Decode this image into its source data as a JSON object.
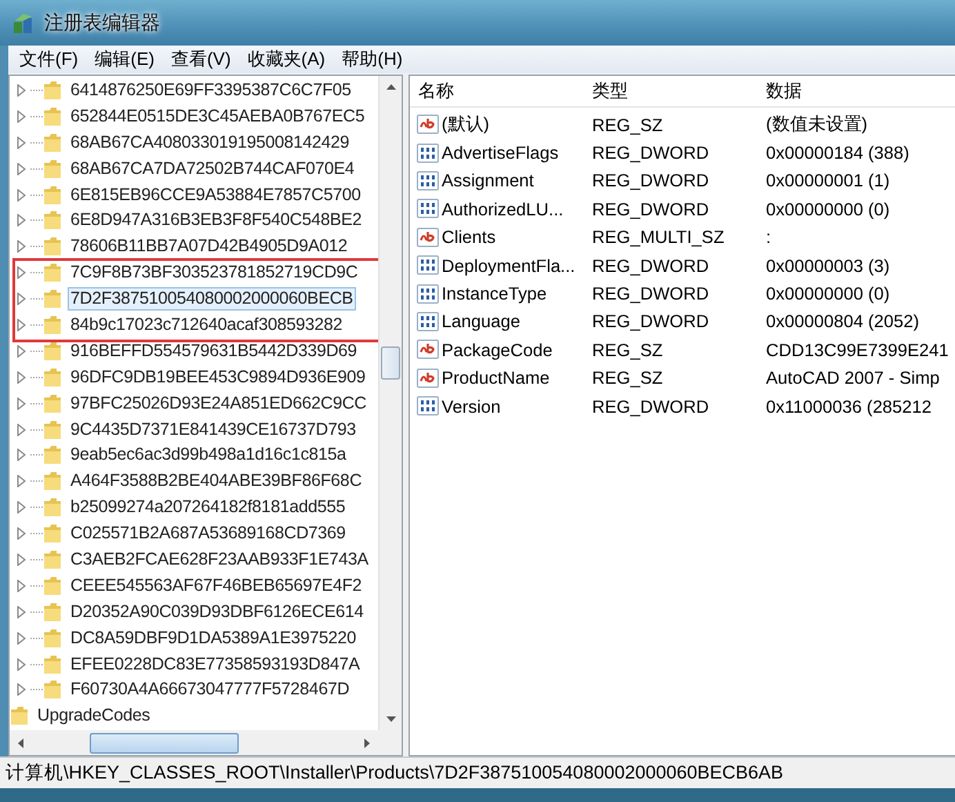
{
  "window": {
    "title": "注册表编辑器"
  },
  "menu": [
    "文件(F)",
    "编辑(E)",
    "查看(V)",
    "收藏夹(A)",
    "帮助(H)"
  ],
  "tree": {
    "items": [
      {
        "label": "6414876250E69FF3395387C6C7F05",
        "expandable": true,
        "selected": false,
        "marked": false
      },
      {
        "label": "652844E0515DE3C45AEBA0B767EC5",
        "expandable": true,
        "selected": false,
        "marked": false
      },
      {
        "label": "68AB67CA408033019195008142429",
        "expandable": true,
        "selected": false,
        "marked": false
      },
      {
        "label": "68AB67CA7DA72502B744CAF070E4",
        "expandable": true,
        "selected": false,
        "marked": false
      },
      {
        "label": "6E815EB96CCE9A53884E7857C5700",
        "expandable": true,
        "selected": false,
        "marked": false
      },
      {
        "label": "6E8D947A316B3EB3F8F540C548BE2",
        "expandable": true,
        "selected": false,
        "marked": false
      },
      {
        "label": "78606B11BB7A07D42B4905D9A012",
        "expandable": true,
        "selected": false,
        "marked": false
      },
      {
        "label": "7C9F8B73BF303523781852719CD9C",
        "expandable": true,
        "selected": false,
        "marked": true
      },
      {
        "label": "7D2F387510054080002000060BECB",
        "expandable": true,
        "selected": true,
        "marked": true
      },
      {
        "label": "84b9c17023c712640acaf308593282",
        "expandable": true,
        "selected": false,
        "marked": true
      },
      {
        "label": "916BEFFD554579631B5442D339D69",
        "expandable": true,
        "selected": false,
        "marked": false
      },
      {
        "label": "96DFC9DB19BEE453C9894D936E909",
        "expandable": true,
        "selected": false,
        "marked": false
      },
      {
        "label": "97BFC25026D93E24A851ED662C9CC",
        "expandable": true,
        "selected": false,
        "marked": false
      },
      {
        "label": "9C4435D7371E841439CE16737D793",
        "expandable": true,
        "selected": false,
        "marked": false
      },
      {
        "label": "9eab5ec6ac3d99b498a1d16c1c815a",
        "expandable": true,
        "selected": false,
        "marked": false
      },
      {
        "label": "A464F3588B2BE404ABE39BF86F68C",
        "expandable": true,
        "selected": false,
        "marked": false
      },
      {
        "label": "b25099274a207264182f8181add555",
        "expandable": true,
        "selected": false,
        "marked": false
      },
      {
        "label": "C025571B2A687A53689168CD7369",
        "expandable": true,
        "selected": false,
        "marked": false
      },
      {
        "label": "C3AEB2FCAE628F23AAB933F1E743A",
        "expandable": true,
        "selected": false,
        "marked": false
      },
      {
        "label": "CEEE545563AF67F46BEB65697E4F2",
        "expandable": true,
        "selected": false,
        "marked": false
      },
      {
        "label": "D20352A90C039D93DBF6126ECE614",
        "expandable": true,
        "selected": false,
        "marked": false
      },
      {
        "label": "DC8A59DBF9D1DA5389A1E3975220",
        "expandable": true,
        "selected": false,
        "marked": false
      },
      {
        "label": "EFEE0228DC83E77358593193D847A",
        "expandable": true,
        "selected": false,
        "marked": false
      },
      {
        "label": "F60730A4A66673047777F5728467D",
        "expandable": true,
        "selected": false,
        "marked": false
      },
      {
        "label": "UpgradeCodes",
        "expandable": false,
        "selected": false,
        "marked": false
      }
    ]
  },
  "values": {
    "columns": [
      "名称",
      "类型",
      "数据"
    ],
    "rows": [
      {
        "kind": "string",
        "name": "(默认)",
        "type": "REG_SZ",
        "data": "(数值未设置)"
      },
      {
        "kind": "binary",
        "name": "AdvertiseFlags",
        "type": "REG_DWORD",
        "data": "0x00000184 (388)"
      },
      {
        "kind": "binary",
        "name": "Assignment",
        "type": "REG_DWORD",
        "data": "0x00000001 (1)"
      },
      {
        "kind": "binary",
        "name": "AuthorizedLU...",
        "type": "REG_DWORD",
        "data": "0x00000000 (0)"
      },
      {
        "kind": "string",
        "name": "Clients",
        "type": "REG_MULTI_SZ",
        "data": ":"
      },
      {
        "kind": "binary",
        "name": "DeploymentFla...",
        "type": "REG_DWORD",
        "data": "0x00000003 (3)"
      },
      {
        "kind": "binary",
        "name": "InstanceType",
        "type": "REG_DWORD",
        "data": "0x00000000 (0)"
      },
      {
        "kind": "binary",
        "name": "Language",
        "type": "REG_DWORD",
        "data": "0x00000804 (2052)"
      },
      {
        "kind": "string",
        "name": "PackageCode",
        "type": "REG_SZ",
        "data": "CDD13C99E7399E241"
      },
      {
        "kind": "string",
        "name": "ProductName",
        "type": "REG_SZ",
        "data": "AutoCAD 2007 - Simp"
      },
      {
        "kind": "binary",
        "name": "Version",
        "type": "REG_DWORD",
        "data": "0x11000036 (285212"
      }
    ]
  },
  "status_bar": "计算机\\HKEY_CLASSES_ROOT\\Installer\\Products\\7D2F387510054080002000060BECB6AB"
}
